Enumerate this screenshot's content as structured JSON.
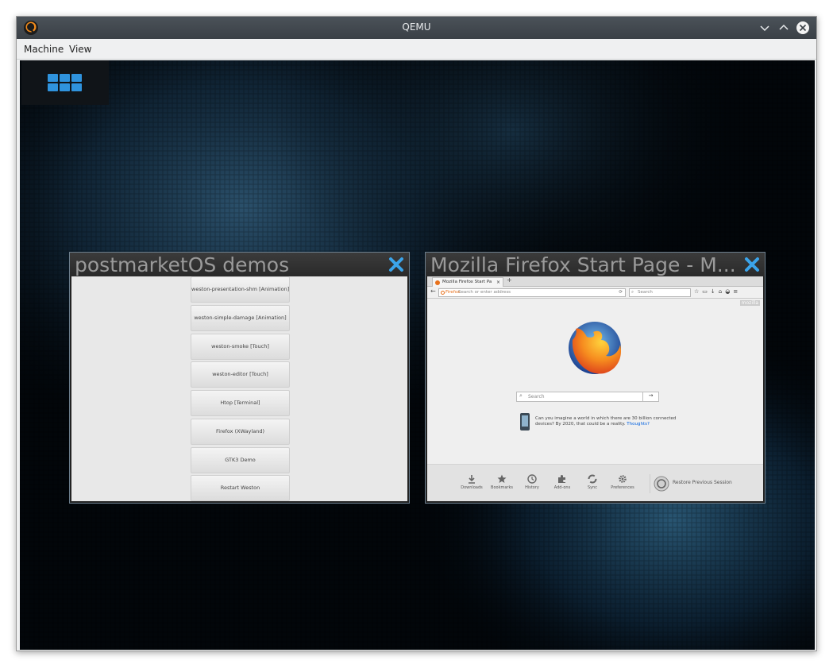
{
  "host_window": {
    "title": "QEMU",
    "menu": [
      "Machine",
      "View"
    ]
  },
  "guest": {
    "windows": [
      {
        "title": "postmarketOS demos",
        "buttons": [
          "weston-presentation-shm [Animation]",
          "weston-simple-damage [Animation]",
          "weston-smoke [Touch]",
          "weston-editor [Touch]",
          "Htop [Terminal]",
          "Firefox (XWayland)",
          "GTK3 Demo",
          "Restart Weston"
        ]
      },
      {
        "title": "Mozilla Firefox Start Page - M...",
        "tab_title": "Mozilla Firefox Start Pa",
        "url_placeholder": "Search or enter address",
        "url_prefix": "Firefox",
        "toolbar_search_placeholder": "Search",
        "mozilla_badge": "mozilla",
        "page_search_placeholder": "Search",
        "snippet_text": "Can you imagine a world in which there are 30 billion connected devices? By 2020, that could be a reality.",
        "snippet_link": "Thoughts?",
        "footer_items": [
          "Downloads",
          "Bookmarks",
          "History",
          "Add-ons",
          "Sync",
          "Preferences"
        ],
        "restore_session": "Restore Previous Session"
      }
    ]
  },
  "colors": {
    "accent": "#2f93dd",
    "titlebar": "#3a4046",
    "desktop": "#02060a"
  }
}
